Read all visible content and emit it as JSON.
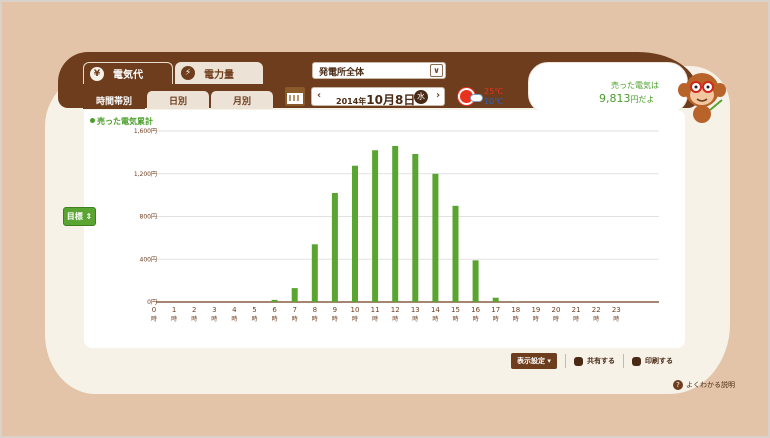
{
  "header": {
    "tabs": [
      {
        "label": "電気代",
        "icon": "yen-icon",
        "glyph": "¥",
        "active": true
      },
      {
        "label": "電力量",
        "icon": "lightning-icon",
        "glyph": "⚡",
        "active": false
      }
    ],
    "scope_select": {
      "value": "発電所全体"
    }
  },
  "subtabs": [
    {
      "label": "時間帯別",
      "active": true
    },
    {
      "label": "日別",
      "active": false
    },
    {
      "label": "月別",
      "active": false
    }
  ],
  "date_nav": {
    "prefix": "2014年",
    "date_big": "10月8日",
    "weekday": "水",
    "prev": "‹",
    "next": "›"
  },
  "weather": {
    "icon": "sun-cloud-icon",
    "high": "25℃",
    "low": "10℃"
  },
  "sold_summary": {
    "label": "売った電気は",
    "value": "9,813",
    "unit": "円だよ"
  },
  "goal_button": {
    "label": "目標 ⇕"
  },
  "legend": {
    "label": "売った電気累計"
  },
  "chart_data": {
    "type": "bar",
    "series": [
      {
        "name": "売った電気累計",
        "color": "#5aa532"
      }
    ],
    "categories": [
      "0",
      "1",
      "2",
      "3",
      "4",
      "5",
      "6",
      "7",
      "8",
      "9",
      "10",
      "11",
      "12",
      "13",
      "14",
      "15",
      "16",
      "17",
      "18",
      "19",
      "20",
      "21",
      "22",
      "23"
    ],
    "category_suffix": "時",
    "values": [
      0,
      0,
      0,
      0,
      0,
      0,
      20,
      130,
      540,
      1020,
      1275,
      1420,
      1460,
      1385,
      1200,
      900,
      390,
      40,
      3,
      0,
      0,
      0,
      0,
      0
    ],
    "ylim": [
      0,
      1600
    ],
    "yticks": [
      0,
      400,
      800,
      1200,
      1600
    ],
    "ytick_labels": [
      "0円",
      "400円",
      "800円",
      "1,200円",
      "1,600円"
    ],
    "grid": true
  },
  "footer": {
    "display_settings": "表示設定 ▾",
    "share": "共有する",
    "print": "印刷する",
    "help": "よくわかる説明"
  },
  "colors": {
    "brown": "#6e3d1d",
    "green": "#5aa532",
    "background": "#e4c4a8"
  }
}
